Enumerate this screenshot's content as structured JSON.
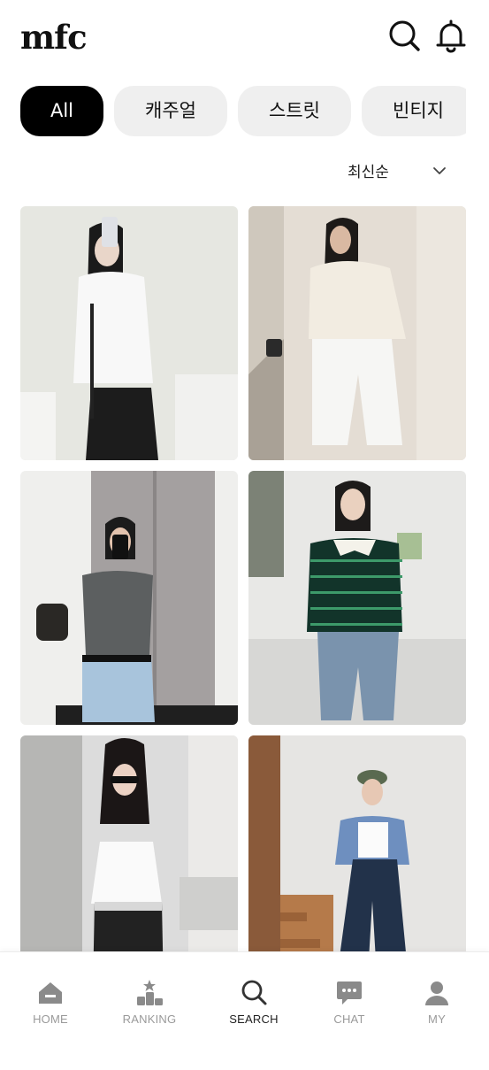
{
  "app": {
    "logo": "mfc"
  },
  "header": {
    "search_icon": "search-icon",
    "notification_icon": "bell-icon"
  },
  "filters": [
    {
      "label": "All",
      "active": true
    },
    {
      "label": "캐주얼",
      "active": false
    },
    {
      "label": "스트릿",
      "active": false
    },
    {
      "label": "빈티지",
      "active": false
    }
  ],
  "sort": {
    "selected": "최신순",
    "icon": "chevron-down-icon"
  },
  "feed": {
    "items": [
      {
        "description_icon": "outfit-photo"
      },
      {
        "description_icon": "outfit-photo"
      },
      {
        "description_icon": "outfit-photo"
      },
      {
        "description_icon": "outfit-photo"
      },
      {
        "description_icon": "outfit-photo"
      },
      {
        "description_icon": "outfit-photo"
      }
    ]
  },
  "tabbar": {
    "items": [
      {
        "label": "HOME",
        "icon": "home-icon",
        "active": false
      },
      {
        "label": "RANKING",
        "icon": "ranking-icon",
        "active": false
      },
      {
        "label": "SEARCH",
        "icon": "search-icon",
        "active": true
      },
      {
        "label": "CHAT",
        "icon": "chat-icon",
        "active": false
      },
      {
        "label": "MY",
        "icon": "user-icon",
        "active": false
      }
    ]
  },
  "colors": {
    "accent": "#000000",
    "chip_bg": "#efefef",
    "tab_inactive": "#9a9a9a",
    "tab_icon": "#8a8a8a"
  }
}
